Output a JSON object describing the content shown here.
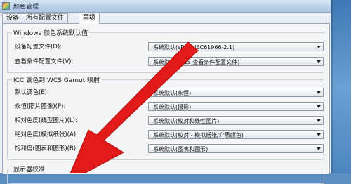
{
  "window": {
    "title": "颜色管理"
  },
  "tabs": [
    {
      "label": "设备"
    },
    {
      "label": "所有配置文件"
    },
    {
      "label": "高级"
    }
  ],
  "groups": {
    "windows_defaults": {
      "title": "Windows 颜色系统默认值",
      "rows": [
        {
          "label": "设备配置文件(D):",
          "value": "系统默认(sRGB IEC61966-2.1)"
        },
        {
          "label": "查看条件配置文件(V):",
          "value": "系统默认(WCS 查看条件配置文件)"
        }
      ]
    },
    "icc_gamut": {
      "title": "ICC 调色到 WCS Gamut 映射",
      "rows": [
        {
          "label": "默认调色(E):",
          "value": "系统默认(永恒)"
        },
        {
          "label": "永恒(照片图像)(P):",
          "value": "系统默认(摄影)"
        },
        {
          "label": "相对色度(线型图片)(L):",
          "value": "系统默认(校对和线性图片)"
        },
        {
          "label": "绝对色度(模拟纸张)(A):",
          "value": "系统默认(校对 - 模拟纸张/介质颜色)"
        },
        {
          "label": "饱和度(图表和图形)(B):",
          "value": "系统默认(图表和图形)"
        }
      ]
    },
    "calibration": {
      "title": "显示器校准"
    }
  },
  "colors": {
    "arrow": "#e21a1a",
    "titlebar": "#bcd2ea",
    "window_bg": "#f5f5f5"
  }
}
